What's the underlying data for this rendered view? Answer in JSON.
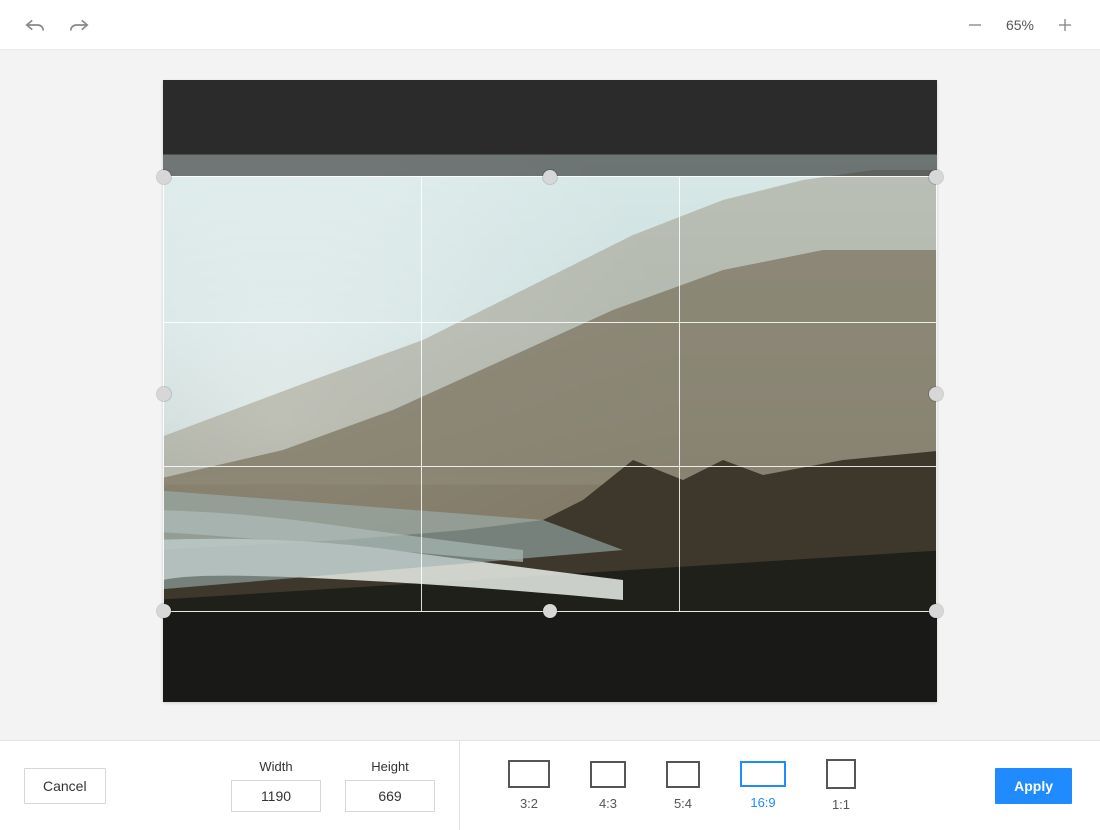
{
  "toolbar": {
    "zoom_level": "65%"
  },
  "crop": {
    "top_pct": 15.5,
    "bottom_pct": 14.5
  },
  "footer": {
    "cancel_label": "Cancel",
    "apply_label": "Apply",
    "width_label": "Width",
    "height_label": "Height",
    "width_value": "1190",
    "height_value": "669",
    "ratios": [
      {
        "key": "3:2",
        "label": "3:2",
        "cls": "r-3-2",
        "active": false
      },
      {
        "key": "4:3",
        "label": "4:3",
        "cls": "r-4-3",
        "active": false
      },
      {
        "key": "5:4",
        "label": "5:4",
        "cls": "r-5-4",
        "active": false
      },
      {
        "key": "16:9",
        "label": "16:9",
        "cls": "r-16-9",
        "active": true
      },
      {
        "key": "1:1",
        "label": "1:1",
        "cls": "r-1-1",
        "active": false
      }
    ]
  }
}
